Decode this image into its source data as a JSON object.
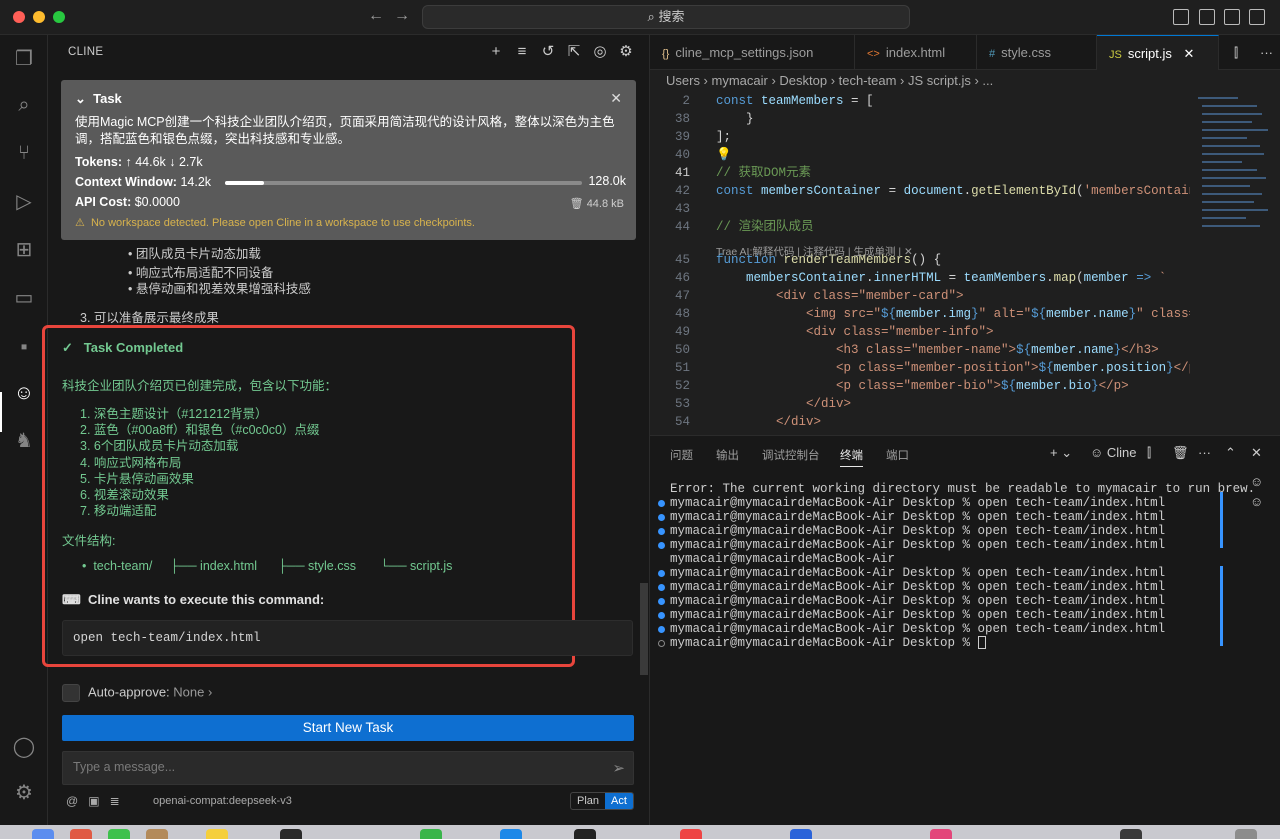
{
  "titlebar": {
    "search_label": "⌕ 搜索"
  },
  "sidebar": {
    "title": "CLINE",
    "task": {
      "header": "Task",
      "description": "使用Magic MCP创建一个科技企业团队介绍页，页面采用简洁现代的设计风格，整体以深色为主色调，搭配蓝色和银色点缀，突出科技感和专业感。",
      "tokens_label": "Tokens:",
      "tokens_value": "↑ 44.6k ↓ 2.7k",
      "context_label": "Context Window:",
      "context_used": "14.2k",
      "context_max": "128.0k",
      "context_fraction": 0.11,
      "api_cost_label": "API Cost:",
      "api_cost_value": "$0.0000",
      "size": "44.8 kB",
      "warning": "No workspace detected. Please open Cline in a workspace to use checkpoints."
    },
    "background_list": [
      "团队成员卡片动态加载",
      "响应式布局适配不同设备",
      "悬停动画和视差效果增强科技感"
    ],
    "background_step": "3. 可以准备展示最终成果",
    "completed": {
      "title": "Task Completed",
      "summary": "科技企业团队介绍页已创建完成，包含以下功能：",
      "features": [
        "1. 深色主题设计（#121212背景）",
        "2. 蓝色（#00a8ff）和银色（#c0c0c0）点缀",
        "3. 6个团队成员卡片动态加载",
        "4. 响应式网格布局",
        "5. 卡片悬停动画效果",
        "6. 视差滚动效果",
        "7. 移动端适配"
      ],
      "structure_label": "文件结构:",
      "structure_items": [
        "tech-team/",
        "├── index.html",
        "├── style.css",
        "└── script.js"
      ]
    },
    "command_label": "Cline wants to execute this command:",
    "command": "open tech-team/index.html",
    "auto_approve_label": "Auto-approve:",
    "auto_approve_value": "None",
    "new_task_button": "Start New Task",
    "message_placeholder": "Type a message...",
    "model": "openai-compat:deepseek-v3",
    "mode_plan": "Plan",
    "mode_act": "Act"
  },
  "editor": {
    "tabs": [
      {
        "icon": "{}",
        "label": "cline_mcp_settings.json"
      },
      {
        "icon": "<>",
        "label": "index.html"
      },
      {
        "icon": "#",
        "label": "style.css"
      },
      {
        "icon": "JS",
        "label": "script.js"
      }
    ],
    "breadcrumb": "Users › mymacair › Desktop › tech-team › JS script.js › ...",
    "codelens": "Trae AI:解释代码 | 注释代码 | 生成单测 | ✕",
    "lines": [
      {
        "n": "2",
        "text": "const teamMembers = ["
      },
      {
        "n": "38",
        "text": "    }"
      },
      {
        "n": "39",
        "text": "];"
      },
      {
        "n": "40",
        "text": ""
      },
      {
        "n": "41",
        "text": "// 获取DOM元素"
      },
      {
        "n": "42",
        "text": "const membersContainer = document.getElementById('membersContainer"
      },
      {
        "n": "43",
        "text": ""
      },
      {
        "n": "44",
        "text": "// 渲染团队成员"
      },
      {
        "n": "45",
        "text": "function renderTeamMembers() {"
      },
      {
        "n": "46",
        "text": "    membersContainer.innerHTML = teamMembers.map(member => `"
      },
      {
        "n": "47",
        "text": "        <div class=\"member-card\">"
      },
      {
        "n": "48",
        "text": "            <img src=\"${member.img}\" alt=\"${member.name}\" class=\"me"
      },
      {
        "n": "49",
        "text": "            <div class=\"member-info\">"
      },
      {
        "n": "50",
        "text": "                <h3 class=\"member-name\">${member.name}</h3>"
      },
      {
        "n": "51",
        "text": "                <p class=\"member-position\">${member.position}</p>"
      },
      {
        "n": "52",
        "text": "                <p class=\"member-bio\">${member.bio}</p>"
      },
      {
        "n": "53",
        "text": "            </div>"
      },
      {
        "n": "54",
        "text": "        </div>"
      }
    ]
  },
  "panel": {
    "tabs": [
      "问题",
      "输出",
      "调试控制台",
      "终端",
      "端口"
    ],
    "active_tab": "终端",
    "cline_label": "Cline",
    "terminal_lines": [
      "Error: The current working directory must be readable to mymacair to run brew.",
      "mymacair@mymacairdeMacBook-Air Desktop % open tech-team/index.html",
      "mymacair@mymacairdeMacBook-Air Desktop % open tech-team/index.html",
      "mymacair@mymacairdeMacBook-Air Desktop % open tech-team/index.html",
      "mymacair@mymacairdeMacBook-Air Desktop % open tech-team/index.html",
      "mymacair@mymacairdeMacBook-Air",
      "mymacair@mymacairdeMacBook-Air Desktop % open tech-team/index.html",
      "mymacair@mymacairdeMacBook-Air Desktop % open tech-team/index.html",
      "mymacair@mymacairdeMacBook-Air Desktop % open tech-team/index.html",
      "mymacair@mymacairdeMacBook-Air Desktop % open tech-team/index.html",
      "mymacair@mymacairdeMacBook-Air Desktop % open tech-team/index.html",
      "mymacair@mymacairdeMacBook-Air Desktop % "
    ]
  },
  "colors": {
    "accent": "#0e6fd1",
    "success": "#73c991",
    "highlight": "#e8453c"
  }
}
